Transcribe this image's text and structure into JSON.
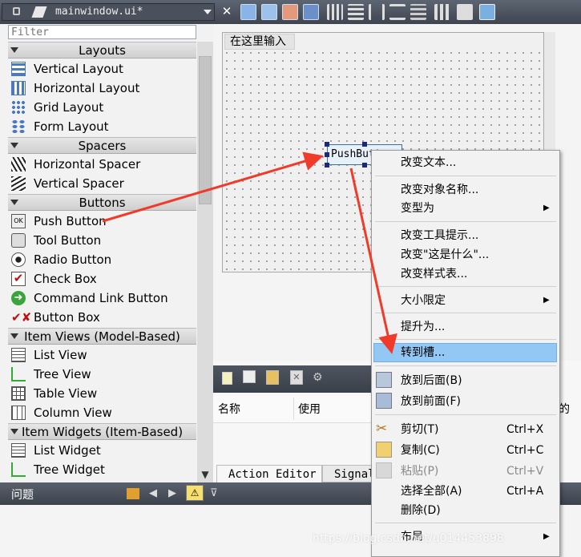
{
  "document": {
    "title": "mainwindow.ui*"
  },
  "widgetbox": {
    "filter_placeholder": "Filter",
    "categories": {
      "layouts": "Layouts",
      "spacers": "Spacers",
      "buttons": "Buttons",
      "item_views": "Item Views (Model-Based)",
      "item_widgets": "Item Widgets (Item-Based)"
    },
    "items": {
      "vertical_layout": "Vertical Layout",
      "horizontal_layout": "Horizontal Layout",
      "grid_layout": "Grid Layout",
      "form_layout": "Form Layout",
      "horizontal_spacer": "Horizontal Spacer",
      "vertical_spacer": "Vertical Spacer",
      "push_button": "Push Button",
      "tool_button": "Tool Button",
      "radio_button": "Radio Button",
      "check_box": "Check Box",
      "command_link_button": "Command Link Button",
      "button_box": "Button Box",
      "list_view": "List View",
      "tree_view": "Tree View",
      "table_view": "Table View",
      "column_view": "Column View",
      "list_widget": "List Widget",
      "tree_widget": "Tree Widget"
    }
  },
  "form": {
    "menu_placeholder": "在这里输入",
    "push_button_text": "PushButton"
  },
  "action_editor": {
    "col_name": "名称",
    "col_used": "使用",
    "tab_action_editor": "Action Editor",
    "tab_signal": "Signal",
    "partial_col": "的"
  },
  "bottom": {
    "issues_label": "问题"
  },
  "context_menu": {
    "change_text": "改变文本...",
    "change_object_name": "改变对象名称...",
    "morph_into": "变型为",
    "change_tooltip": "改变工具提示...",
    "change_whats_this": "改变\"这是什么\"...",
    "change_stylesheet": "改变样式表...",
    "size_constraints": "大小限定",
    "promote_to": "提升为...",
    "go_to_slot": "转到槽...",
    "send_to_back": "放到后面(B)",
    "bring_to_front": "放到前面(F)",
    "cut": "剪切(T)",
    "cut_shortcut": "Ctrl+X",
    "copy": "复制(C)",
    "copy_shortcut": "Ctrl+C",
    "paste": "粘贴(P)",
    "paste_shortcut": "Ctrl+V",
    "select_all": "选择全部(A)",
    "select_all_shortcut": "Ctrl+A",
    "delete": "删除(D)",
    "layout": "布局"
  },
  "watermark": "https://blog.csdn.net/u014453898",
  "colors": {
    "highlight": "#93c8f5",
    "arrow": "#f03a2a",
    "toolbar": "#4a515c"
  }
}
